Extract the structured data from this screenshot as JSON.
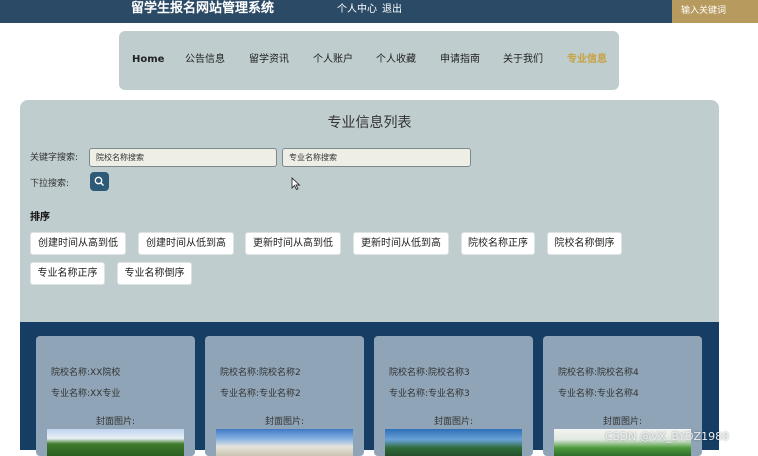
{
  "header": {
    "site_title": "留学生报名网站管理系统",
    "links": [
      "个人中心",
      "退出"
    ],
    "search_placeholder": "输入关键词",
    "color": "#2b4a66",
    "search_color": "#b79a5e"
  },
  "nav": {
    "items": [
      "Home",
      "公告信息",
      "留学资讯",
      "个人账户",
      "个人收藏",
      "申请指南",
      "关于我们",
      "专业信息"
    ],
    "active": "专业信息",
    "active_color": "#c9a13f"
  },
  "list": {
    "title": "专业信息列表",
    "keyword_label": "关键字搜索:",
    "school_placeholder": "院校名称搜索",
    "major_placeholder": "专业名称搜索",
    "dropdown_label": "下拉搜索:",
    "search_icon": "search-icon"
  },
  "sort": {
    "title": "排序",
    "buttons": [
      "创建时间从高到低",
      "创建时间从低到高",
      "更新时间从高到低",
      "更新时间从低到高",
      "院校名称正序",
      "院校名称倒序",
      "专业名称正序",
      "专业名称倒序"
    ]
  },
  "cards": [
    {
      "school": "院校名称:XX院校",
      "major": "专业名称:XX专业",
      "cover_label": "封面图片:"
    },
    {
      "school": "院校名称:院校名称2",
      "major": "专业名称:专业名称2",
      "cover_label": "封面图片:"
    },
    {
      "school": "院校名称:院校名称3",
      "major": "专业名称:专业名称3",
      "cover_label": "封面图片:"
    },
    {
      "school": "院校名称:院校名称4",
      "major": "专业名称:专业名称4",
      "cover_label": "封面图片:"
    }
  ],
  "watermark": "CSDN @VX_BYDZ1988"
}
